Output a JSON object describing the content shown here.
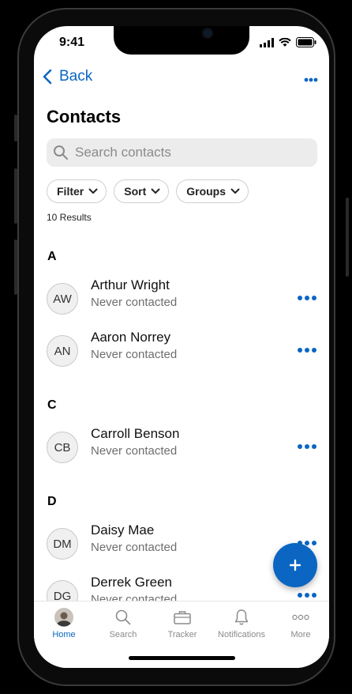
{
  "status_bar": {
    "time": "9:41"
  },
  "nav": {
    "back_label": "Back"
  },
  "page": {
    "title": "Contacts"
  },
  "search": {
    "placeholder": "Search contacts"
  },
  "filters": [
    {
      "label": "Filter"
    },
    {
      "label": "Sort"
    },
    {
      "label": "Groups"
    }
  ],
  "results_count": "10 Results",
  "sections": [
    {
      "letter": "A",
      "contacts": [
        {
          "initials": "AW",
          "name": "Arthur Wright",
          "status": "Never contacted"
        },
        {
          "initials": "AN",
          "name": "Aaron Norrey",
          "status": "Never contacted"
        }
      ]
    },
    {
      "letter": "C",
      "contacts": [
        {
          "initials": "CB",
          "name": "Carroll Benson",
          "status": "Never contacted"
        }
      ]
    },
    {
      "letter": "D",
      "contacts": [
        {
          "initials": "DM",
          "name": "Daisy Mae",
          "status": "Never contacted"
        },
        {
          "initials": "DG",
          "name": "Derrek Green",
          "status": "Never contacted"
        }
      ]
    }
  ],
  "tabs": [
    {
      "label": "Home",
      "icon": "avatar-photo",
      "active": true
    },
    {
      "label": "Search",
      "icon": "search-icon"
    },
    {
      "label": "Tracker",
      "icon": "briefcase-icon"
    },
    {
      "label": "Notifications",
      "icon": "bell-icon"
    },
    {
      "label": "More",
      "icon": "more-horizontal-icon"
    }
  ],
  "colors": {
    "accent": "#0a66c2",
    "text": "#111111",
    "secondary": "#6e6e6e"
  }
}
